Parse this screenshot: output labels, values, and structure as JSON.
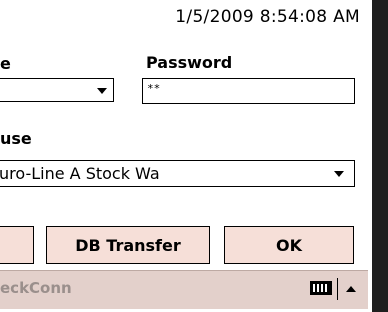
{
  "header": {
    "timestamp": "1/5/2009 8:54:08 AM"
  },
  "form": {
    "username_label": "e",
    "password_label": "Password",
    "password_value": "**",
    "warehouse_label": "use",
    "warehouse_value": "uro-Line A Stock Wa"
  },
  "buttons": {
    "db_transfer": "DB Transfer",
    "ok": "OK"
  },
  "taskbar": {
    "title": "eckConn",
    "icons": [
      "keyboard-icon",
      "up-arrow-icon"
    ]
  },
  "colors": {
    "button_bg": "#f6dfd8",
    "taskbar_bg": "#e3d0cb",
    "right_bar": "#1f1f1f"
  }
}
